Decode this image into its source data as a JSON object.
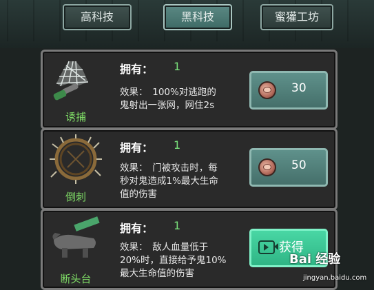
{
  "tabs": [
    {
      "label": "高科技",
      "active": false
    },
    {
      "label": "黑科技",
      "active": true
    },
    {
      "label": "蜜獾工坊",
      "active": false
    }
  ],
  "items": [
    {
      "name": "诱捕",
      "own_label": "拥有：",
      "own_value": "1",
      "effect_line1": "效果：　100%对逃跑的",
      "effect_line2": "鬼射出一张网，网住2s",
      "price": "30",
      "icon": "net-trap-icon"
    },
    {
      "name": "倒刺",
      "own_label": "拥有：",
      "own_value": "1",
      "effect_line1": "效果：　门被攻击时，每",
      "effect_line2": "秒对鬼造成1%最大生命",
      "effect_line3": "值的伤害",
      "price": "50",
      "icon": "thorn-ring-icon"
    },
    {
      "name": "断头台",
      "own_label": "拥有：",
      "own_value": "1",
      "effect_line1": "效果：　敌人血量低于",
      "effect_line2": "20%时，直接给予鬼10%",
      "effect_line3": "最大生命值的伤害",
      "action_label": "获得",
      "icon": "guillotine-icon"
    }
  ],
  "watermark": {
    "text": "Bai 经验",
    "url": "jingyan.baidu.com"
  },
  "colors": {
    "accent_green": "#7fdc66",
    "button_teal": "#5f918b",
    "get_button": "#3fcf9a"
  }
}
